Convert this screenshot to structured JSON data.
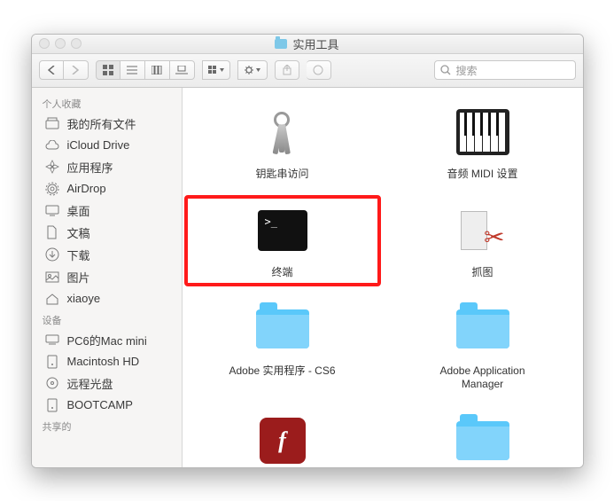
{
  "window": {
    "title": "实用工具"
  },
  "search": {
    "placeholder": "搜索"
  },
  "sidebar": {
    "sections": [
      {
        "header": "个人收藏",
        "items": [
          {
            "label": "我的所有文件",
            "icon": "all-files"
          },
          {
            "label": "iCloud Drive",
            "icon": "cloud"
          },
          {
            "label": "应用程序",
            "icon": "apps"
          },
          {
            "label": "AirDrop",
            "icon": "airdrop"
          },
          {
            "label": "桌面",
            "icon": "desktop"
          },
          {
            "label": "文稿",
            "icon": "documents"
          },
          {
            "label": "下载",
            "icon": "downloads"
          },
          {
            "label": "图片",
            "icon": "pictures"
          },
          {
            "label": "xiaoye",
            "icon": "home"
          }
        ]
      },
      {
        "header": "设备",
        "items": [
          {
            "label": "PC6的Mac mini",
            "icon": "computer"
          },
          {
            "label": "Macintosh HD",
            "icon": "disk"
          },
          {
            "label": "远程光盘",
            "icon": "remote-disc"
          },
          {
            "label": "BOOTCAMP",
            "icon": "disk"
          }
        ]
      },
      {
        "header": "共享的",
        "items": []
      }
    ]
  },
  "items": [
    {
      "label": "钥匙串访问",
      "icon": "keychain",
      "highlight": false
    },
    {
      "label": "音频 MIDI 设置",
      "icon": "midi",
      "highlight": false
    },
    {
      "label": "终端",
      "icon": "terminal",
      "highlight": true
    },
    {
      "label": "抓图",
      "icon": "grab",
      "highlight": false
    },
    {
      "label": "Adobe 实用程序 - CS6",
      "icon": "folder",
      "highlight": false
    },
    {
      "label": "Adobe Application Manager",
      "icon": "folder",
      "highlight": false
    },
    {
      "label": "",
      "icon": "flash",
      "highlight": false
    },
    {
      "label": "",
      "icon": "folder",
      "highlight": false
    }
  ]
}
